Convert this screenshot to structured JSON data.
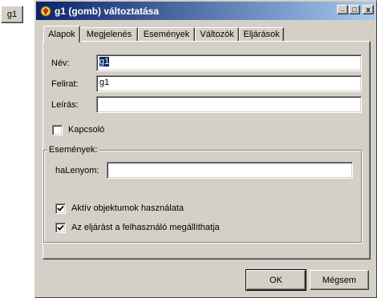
{
  "preview_button": {
    "label": "g1"
  },
  "window": {
    "title": "g1 (gomb) változtatása",
    "controls": {
      "minimize": "_",
      "maximize": "□",
      "close": "x"
    }
  },
  "tabs": [
    {
      "label": "Alapok",
      "active": true
    },
    {
      "label": "Megjelenés"
    },
    {
      "label": "Események"
    },
    {
      "label": "Változók"
    },
    {
      "label": "Eljárások"
    }
  ],
  "form": {
    "nev": {
      "label": "Név:",
      "value": "g1"
    },
    "felirat": {
      "label": "Felirat:",
      "value": "g1"
    },
    "leiras": {
      "label": "Leírás:",
      "value": ""
    },
    "kapcsolo": {
      "label": "Kapcsoló",
      "checked": false
    }
  },
  "events_group": {
    "legend": "Események:",
    "halenyom": {
      "label": "haLenyom:",
      "value": ""
    },
    "aktiv": {
      "label": "Aktív objektumok használata",
      "checked": true
    },
    "megallithato": {
      "label": "Az eljárást a felhasználó megállíthatja",
      "checked": true
    }
  },
  "buttons": {
    "ok": "OK",
    "cancel": "Mégsem"
  }
}
